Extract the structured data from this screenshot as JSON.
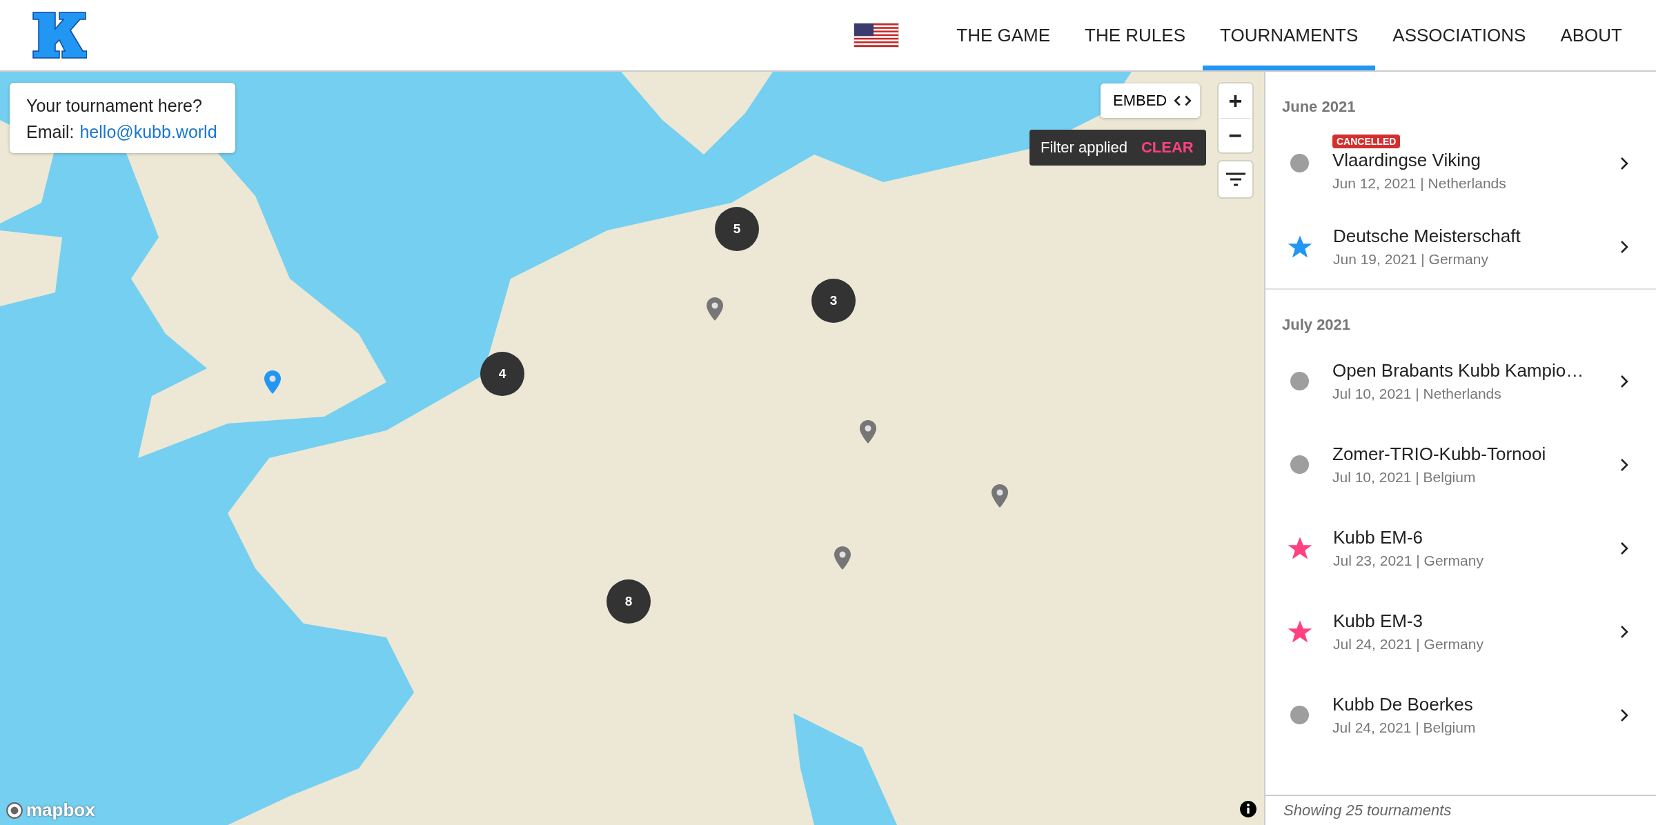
{
  "nav": {
    "items": [
      {
        "label": "THE GAME",
        "selected": false
      },
      {
        "label": "THE RULES",
        "selected": false
      },
      {
        "label": "TOURNAMENTS",
        "selected": true
      },
      {
        "label": "ASSOCIATIONS",
        "selected": false
      },
      {
        "label": "ABOUT",
        "selected": false
      }
    ]
  },
  "map": {
    "promo": {
      "text": "Your tournament here?",
      "email_label": "Email:",
      "email": "hello@kubb.world"
    },
    "embed_button": "EMBED",
    "zoom_in": "+",
    "zoom_out": "−",
    "filter_toast": {
      "text": "Filter applied",
      "action": "CLEAR"
    },
    "clusters": [
      {
        "count": "5"
      },
      {
        "count": "3"
      },
      {
        "count": "4"
      },
      {
        "count": "8"
      }
    ],
    "pins": [
      {
        "color": "#767676"
      },
      {
        "color": "#767676"
      },
      {
        "color": "#767676"
      },
      {
        "color": "#767676"
      },
      {
        "color": "#2196f3"
      }
    ],
    "attribution": "mapbox"
  },
  "sidebar": {
    "groups": [
      {
        "month": "June 2021",
        "items": [
          {
            "kind": "dot",
            "color": "#9e9e9e",
            "badge": "CANCELLED",
            "name": "Vlaardingse Viking",
            "details": "Jun 12, 2021 | Netherlands"
          },
          {
            "kind": "star",
            "color": "#2196f3",
            "name": "Deutsche Meisterschaft",
            "details": "Jun 19, 2021 | Germany"
          }
        ]
      },
      {
        "month": "July 2021",
        "items": [
          {
            "kind": "dot",
            "color": "#9e9e9e",
            "name": "Open Brabants Kubb Kampio…",
            "details": "Jul 10, 2021 | Netherlands"
          },
          {
            "kind": "dot",
            "color": "#9e9e9e",
            "name": "Zomer-TRIO-Kubb-Tornooi",
            "details": "Jul 10, 2021 | Belgium"
          },
          {
            "kind": "star",
            "color": "#ff4081",
            "name": "Kubb EM-6",
            "details": "Jul 23, 2021 | Germany"
          },
          {
            "kind": "star",
            "color": "#ff4081",
            "name": "Kubb EM-3",
            "details": "Jul 24, 2021 | Germany"
          },
          {
            "kind": "dot",
            "color": "#9e9e9e",
            "name": "Kubb De Boerkes",
            "details": "Jul 24, 2021 | Belgium"
          }
        ]
      }
    ],
    "footer": "Showing 25 tournaments"
  }
}
